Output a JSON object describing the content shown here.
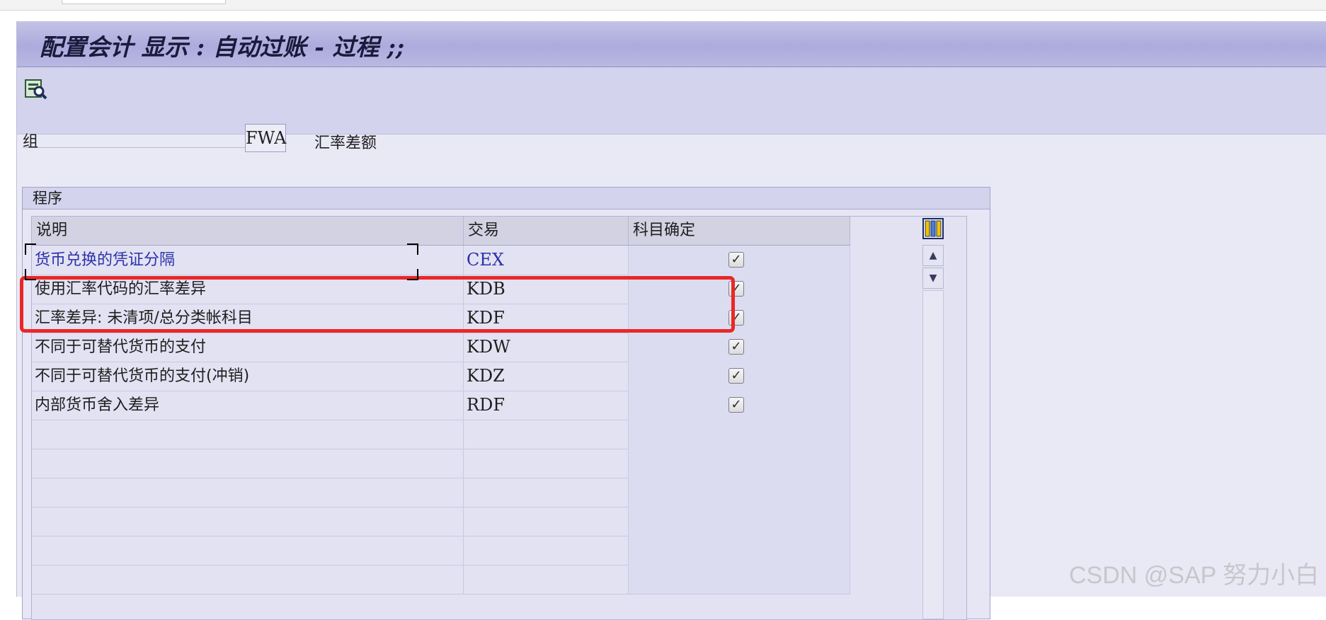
{
  "window": {
    "title": "配置会计 显示 : 自动过账 - 过程 ;;"
  },
  "toolbar": {
    "icon": "display-search-icon"
  },
  "group_field": {
    "label": "组",
    "value": "FWA",
    "description": "汇率差额"
  },
  "procedures": {
    "title": "程序",
    "columns": [
      "说明",
      "交易",
      "科目确定"
    ],
    "rows": [
      {
        "description": "货币兑换的凭证分隔",
        "transaction": "CEX",
        "account_determination": true
      },
      {
        "description": "使用汇率代码的汇率差异",
        "transaction": "KDB",
        "account_determination": true
      },
      {
        "description": "汇率差异: 未清项/总分类帐科目",
        "transaction": "KDF",
        "account_determination": true
      },
      {
        "description": "不同于可替代货币的支付",
        "transaction": "KDW",
        "account_determination": true
      },
      {
        "description": "不同于可替代货币的支付(冲销)",
        "transaction": "KDZ",
        "account_determination": true
      },
      {
        "description": "内部货币舍入差异",
        "transaction": "RDF",
        "account_determination": true
      }
    ],
    "empty_rows": 6
  },
  "watermark": "CSDN @SAP 努力小白",
  "colors": {
    "highlight": "#ea2727",
    "link": "#2c31a8",
    "title_bar": "#acabdd"
  }
}
